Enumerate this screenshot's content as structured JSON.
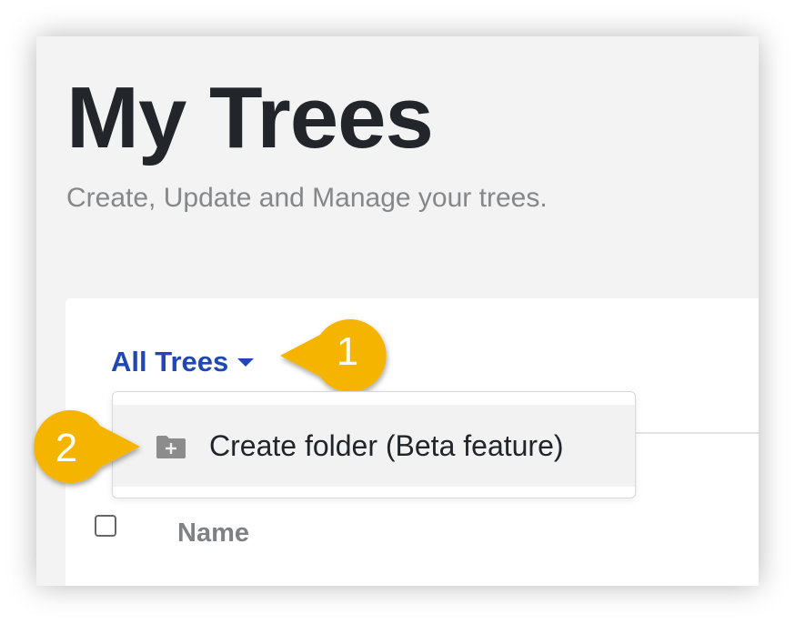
{
  "header": {
    "title": "My Trees",
    "subtitle": "Create, Update and Manage your trees."
  },
  "filter": {
    "label": "All Trees",
    "caret_icon": "caret-down-icon"
  },
  "menu": {
    "items": [
      {
        "label": "Create folder (Beta feature)",
        "icon": "folder-plus-icon"
      }
    ]
  },
  "table": {
    "columns": [
      "Name"
    ]
  },
  "callouts": [
    "1",
    "2"
  ],
  "colors": {
    "accent": "#1f47b5",
    "callout": "#f5b400",
    "title": "#22262b"
  }
}
